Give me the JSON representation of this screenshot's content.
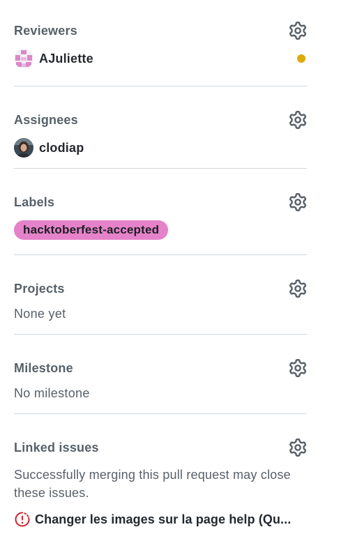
{
  "reviewers": {
    "title": "Reviewers",
    "settings_icon": "gear-icon",
    "people": [
      {
        "name": "AJuliette",
        "status_color": "#dbab09"
      }
    ]
  },
  "assignees": {
    "title": "Assignees",
    "settings_icon": "gear-icon",
    "people": [
      {
        "name": "clodiap"
      }
    ]
  },
  "labels": {
    "title": "Labels",
    "settings_icon": "gear-icon",
    "items": [
      {
        "name": "hacktoberfest-accepted",
        "color": "#e582c9"
      }
    ]
  },
  "projects": {
    "title": "Projects",
    "settings_icon": "gear-icon",
    "empty_text": "None yet"
  },
  "milestone": {
    "title": "Milestone",
    "settings_icon": "gear-icon",
    "empty_text": "No milestone"
  },
  "linked_issues": {
    "title": "Linked issues",
    "settings_icon": "gear-icon",
    "description": "Successfully merging this pull request may close these issues.",
    "issues": [
      {
        "title": "Changer les images sur la page help (Qu...",
        "icon": "issue-draft-icon",
        "color": "#cf222e"
      }
    ]
  }
}
